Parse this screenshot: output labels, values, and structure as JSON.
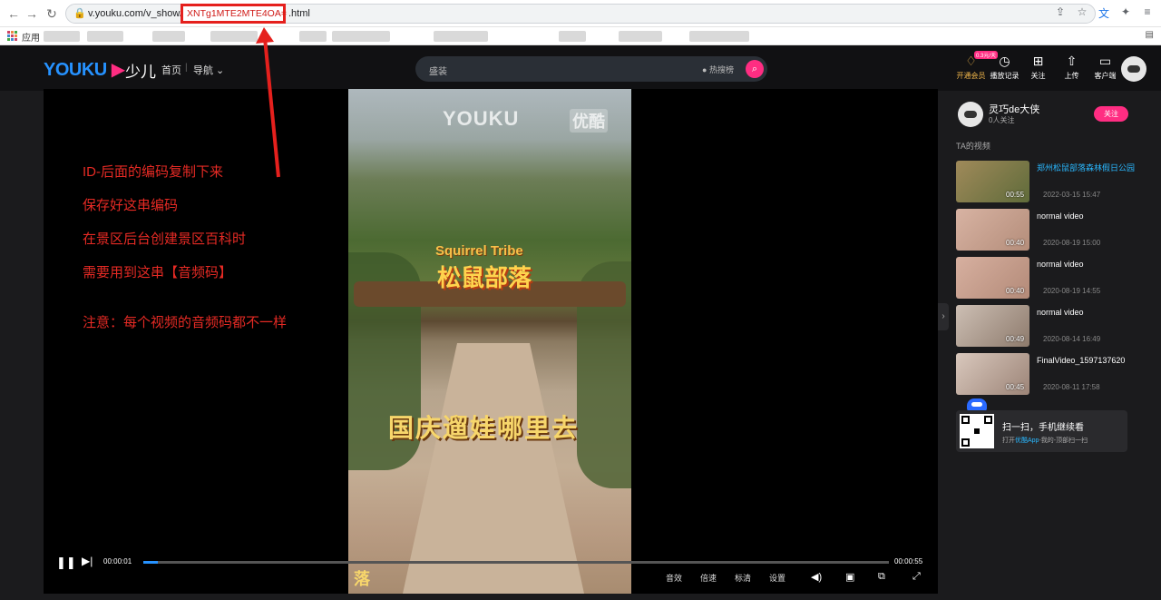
{
  "browser": {
    "url_prefix": "v.youku.com/v_show/i",
    "url_highlight": "XNTg1MTE2MTE4OA=",
    "url_suffix": ".html",
    "apps_label": "应用"
  },
  "header": {
    "logo": "YOUKU",
    "logo_sub": "少儿",
    "nav_home": "首页",
    "nav_sep": "|",
    "nav_menu": "导航",
    "search_placeholder": "盛装",
    "search_hot": "热搜榜",
    "vip_tag": "0.3元/天",
    "items": [
      {
        "label": "开通会员",
        "icon": "diamond-icon"
      },
      {
        "label": "播放记录",
        "icon": "clock-icon"
      },
      {
        "label": "关注",
        "icon": "follow-icon"
      },
      {
        "label": "上传",
        "icon": "upload-icon"
      },
      {
        "label": "客户端",
        "icon": "client-icon"
      }
    ]
  },
  "video": {
    "watermark": "YOUKU",
    "watermark_cn": "优酷",
    "sign_en": "Squirrel Tribe",
    "sign_cn": "松鼠部落",
    "subtitle": "国庆遛娃哪里去",
    "bottom_text": "落"
  },
  "annotations": [
    "ID-后面的编码复制下来",
    "保存好这串编码",
    "在景区后台创建景区百科时",
    "需要用到这串【音频码】",
    "注意：每个视频的音频码都不一样"
  ],
  "player": {
    "current_time": "00:00:01",
    "total_time": "00:00:55",
    "progress": 0.02,
    "controls": [
      "音效",
      "倍速",
      "标清",
      "设置"
    ]
  },
  "sidebar": {
    "uploader_name": "灵巧de大侠",
    "uploader_fans": "0人关注",
    "follow_label": "关注",
    "section_title": "TA的视频",
    "videos": [
      {
        "title": "郑州松鼠部落森林假日公园",
        "duration": "00:55",
        "date": "2022-03-15 15:47",
        "active": true,
        "color": "#7a6a48"
      },
      {
        "title": "normal video",
        "duration": "00:40",
        "date": "2020-08-19 15:00",
        "active": false,
        "color": "#c9a896"
      },
      {
        "title": "normal video",
        "duration": "00:40",
        "date": "2020-08-19 14:55",
        "active": false,
        "color": "#c7a495"
      },
      {
        "title": "normal video",
        "duration": "00:49",
        "date": "2020-08-14 16:49",
        "active": false,
        "color": "#b9aaa0"
      },
      {
        "title": "FinalVideo_1597137620",
        "duration": "00:45",
        "date": "2020-08-11 17:58",
        "active": false,
        "color": "#c4b3a8"
      }
    ],
    "qr_title": "扫一扫，手机继续看",
    "qr_sub_pre": "打开",
    "qr_sub_app": "优酷App",
    "qr_sub_post": "-我的-顶部扫一扫"
  }
}
